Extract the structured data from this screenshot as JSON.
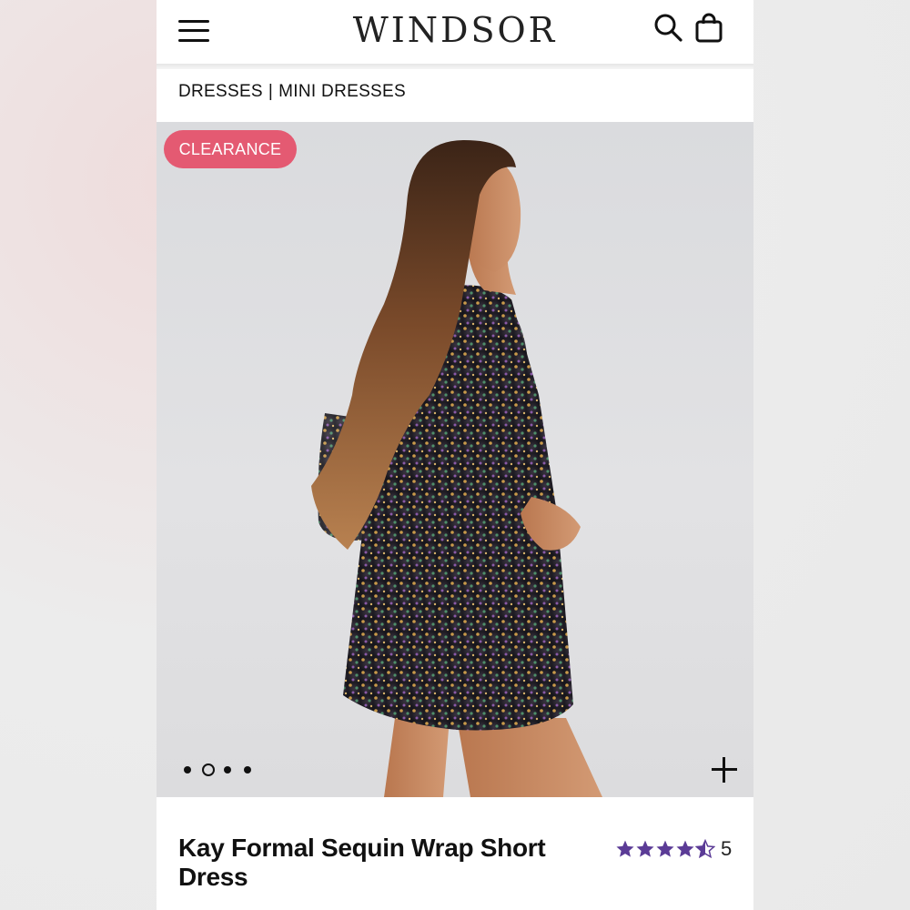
{
  "header": {
    "logo_text": "WINDSOR",
    "menu_icon": "hamburger-menu-icon",
    "search_icon": "search-icon",
    "bag_icon": "shopping-bag-icon"
  },
  "breadcrumb": {
    "items": [
      "DRESSES",
      "MINI DRESSES"
    ],
    "separator": "|"
  },
  "gallery": {
    "badge": "CLEARANCE",
    "badge_color": "#e45a72",
    "image_count": 4,
    "active_index": 1,
    "zoom_icon": "plus-icon"
  },
  "product": {
    "title": "Kay Formal Sequin Wrap Short Dress",
    "rating_value": 4.5,
    "rating_max": 5,
    "review_count": "5",
    "star_color": "#5b3b96"
  }
}
